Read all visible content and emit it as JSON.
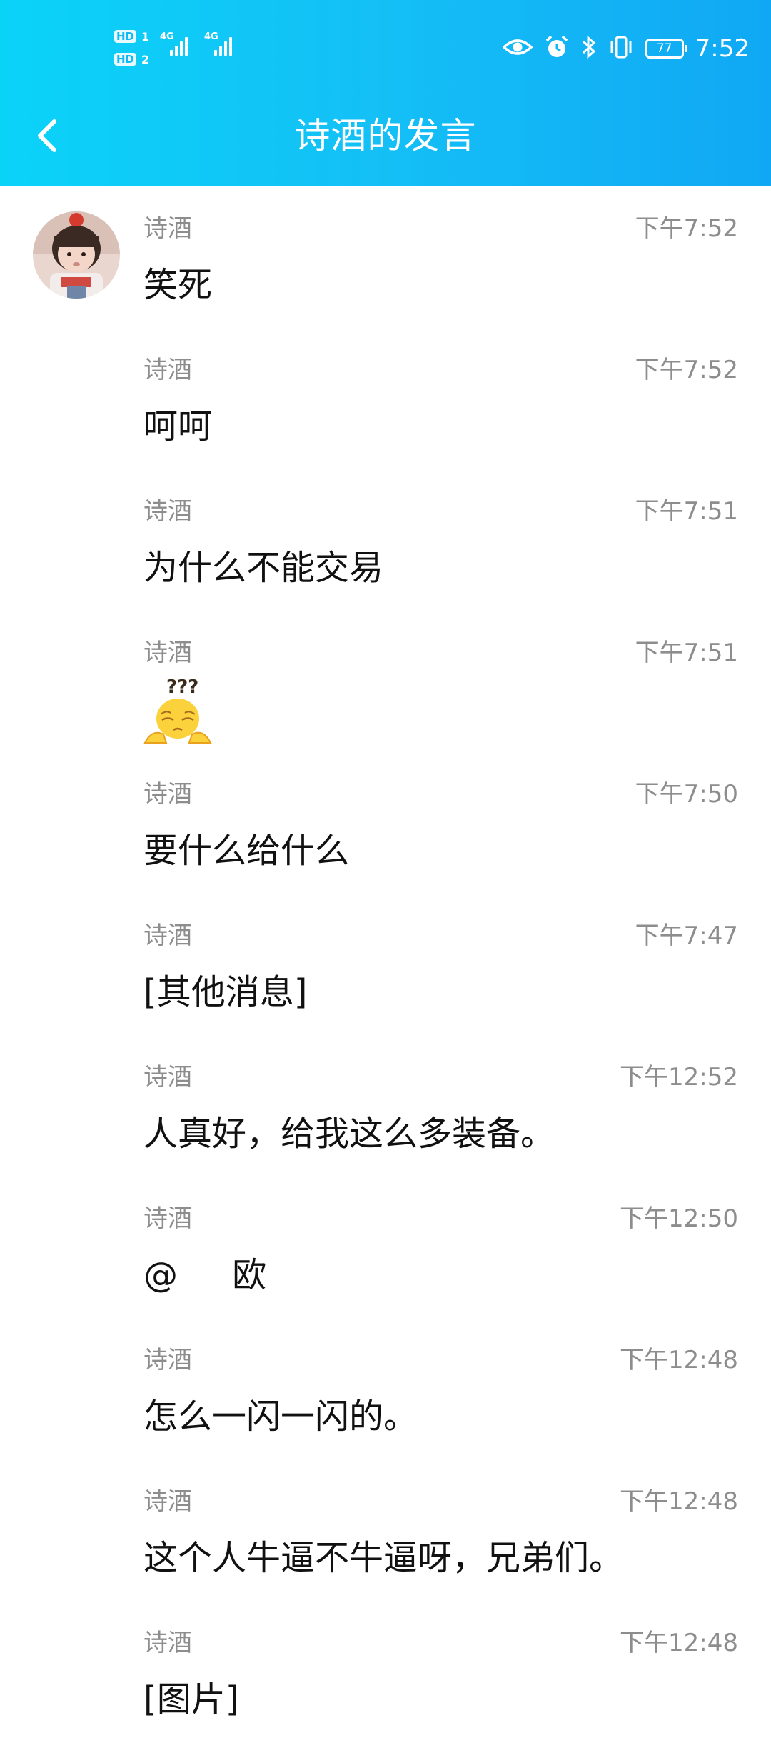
{
  "status_bar": {
    "sim1": "1",
    "sim2": "2",
    "hd": "HD",
    "network1": "4G",
    "network2": "4G",
    "battery": "77",
    "time": "7:52",
    "icons": [
      "eye-icon",
      "alarm-icon",
      "bluetooth-icon",
      "vibrate-icon"
    ]
  },
  "nav": {
    "title": "诗酒的发言",
    "back_icon": "chevron-left-icon"
  },
  "colors": {
    "header_gradient_start": "#0ad3f8",
    "header_gradient_end": "#10a8f4",
    "secondary_text": "#8d8d8d",
    "primary_text": "#111111"
  },
  "messages": [
    {
      "sender": "诗酒",
      "time": "下午7:52",
      "text": "笑死"
    },
    {
      "sender": "诗酒",
      "time": "下午7:52",
      "text": "呵呵"
    },
    {
      "sender": "诗酒",
      "time": "下午7:51",
      "text": "为什么不能交易"
    },
    {
      "sender": "诗酒",
      "time": "下午7:51",
      "text": "",
      "sticker": "confused-emoji-sticker"
    },
    {
      "sender": "诗酒",
      "time": "下午7:50",
      "text": "要什么给什么"
    },
    {
      "sender": "诗酒",
      "time": "下午7:47",
      "text": "[其他消息]"
    },
    {
      "sender": "诗酒",
      "time": "下午12:52",
      "text": "人真好，给我这么多装备。"
    },
    {
      "sender": "诗酒",
      "time": "下午12:50",
      "text": "@     欧"
    },
    {
      "sender": "诗酒",
      "time": "下午12:48",
      "text": "怎么一闪一闪的。"
    },
    {
      "sender": "诗酒",
      "time": "下午12:48",
      "text": "这个人牛逼不牛逼呀，兄弟们。"
    },
    {
      "sender": "诗酒",
      "time": "下午12:48",
      "text": "[图片]"
    }
  ]
}
